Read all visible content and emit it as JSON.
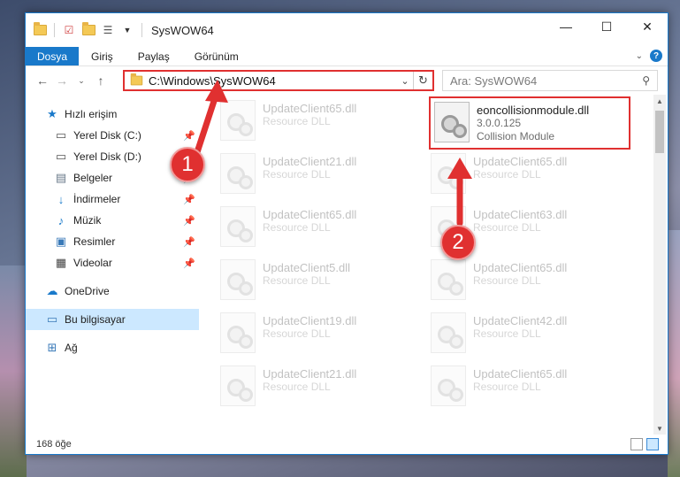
{
  "window": {
    "title": "SysWOW64",
    "controls": {
      "minimize": "—",
      "maximize": "☐",
      "close": "✕"
    }
  },
  "ribbon": {
    "tabs": [
      "Dosya",
      "Giriş",
      "Paylaş",
      "Görünüm"
    ]
  },
  "nav": {
    "address_path": "C:\\Windows\\SysWOW64",
    "search_placeholder": "Ara: SysWOW64"
  },
  "sidebar": {
    "items": [
      {
        "label": "Hızlı erişim",
        "icon": "star-icon",
        "pinned": false
      },
      {
        "label": "Yerel Disk (C:)",
        "icon": "drive-icon",
        "pinned": true
      },
      {
        "label": "Yerel Disk (D:)",
        "icon": "drive-icon",
        "pinned": true
      },
      {
        "label": "Belgeler",
        "icon": "documents-icon",
        "pinned": true
      },
      {
        "label": "İndirmeler",
        "icon": "download-icon",
        "pinned": true
      },
      {
        "label": "Müzik",
        "icon": "music-icon",
        "pinned": true
      },
      {
        "label": "Resimler",
        "icon": "pictures-icon",
        "pinned": true
      },
      {
        "label": "Videolar",
        "icon": "video-icon",
        "pinned": true
      },
      {
        "label": "OneDrive",
        "icon": "cloud-icon",
        "pinned": false
      },
      {
        "label": "Bu bilgisayar",
        "icon": "computer-icon",
        "pinned": false
      },
      {
        "label": "Ağ",
        "icon": "network-icon",
        "pinned": false
      }
    ]
  },
  "files": {
    "highlighted": {
      "name": "eoncollisionmodule.dll",
      "version": "3.0.0.125",
      "description": "Collision Module"
    },
    "left_column": [
      {
        "name": "UpdateClient65.dll",
        "sub": "Resource DLL"
      },
      {
        "name": "UpdateClient21.dll",
        "sub": "Resource DLL"
      },
      {
        "name": "UpdateClient65.dll",
        "sub": "Resource DLL"
      },
      {
        "name": "UpdateClient5.dll",
        "sub": "Resource DLL"
      },
      {
        "name": "UpdateClient19.dll",
        "sub": "Resource DLL"
      },
      {
        "name": "UpdateClient21.dll",
        "sub": "Resource DLL"
      }
    ],
    "right_column": [
      {
        "name": "UpdateClient65.dll",
        "sub": "Resource DLL"
      },
      {
        "name": "UpdateClient63.dll",
        "sub": "Resource DLL"
      },
      {
        "name": "UpdateClient65.dll",
        "sub": "Resource DLL"
      },
      {
        "name": "UpdateClient42.dll",
        "sub": "Resource DLL"
      },
      {
        "name": "UpdateClient65.dll",
        "sub": "Resource DLL"
      }
    ]
  },
  "status": {
    "item_count": "168 öğe"
  },
  "annotations": {
    "step1": "1",
    "step2": "2"
  },
  "colors": {
    "accent": "#1979ca",
    "highlight": "#e03030",
    "selection": "#cce8ff"
  }
}
